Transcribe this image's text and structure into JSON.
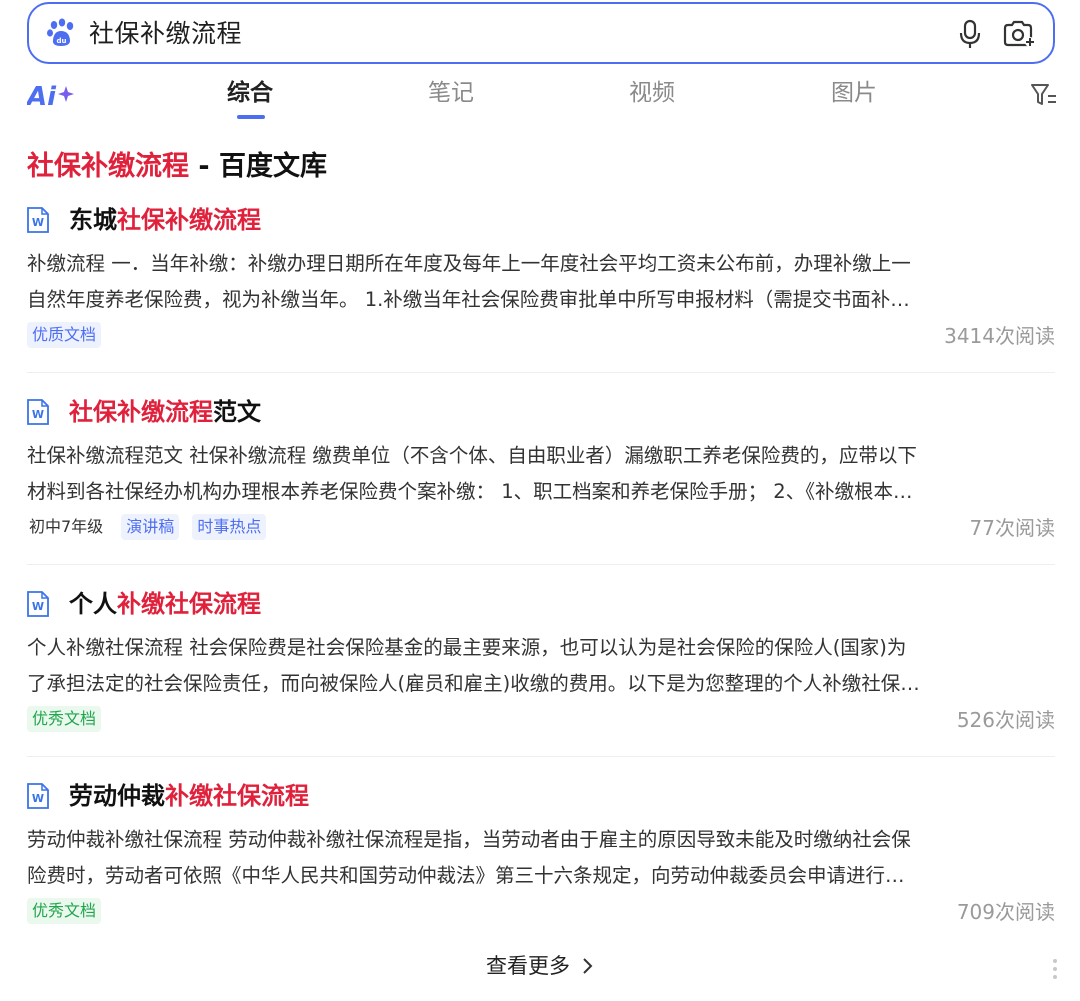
{
  "search": {
    "query": "社保补缴流程"
  },
  "tabs": [
    {
      "label": "综合",
      "active": true
    },
    {
      "label": "笔记",
      "active": false
    },
    {
      "label": "视频",
      "active": false
    },
    {
      "label": "图片",
      "active": false
    }
  ],
  "section": {
    "title_highlight": "社保补缴流程",
    "title_rest": " - 百度文库"
  },
  "results": [
    {
      "title_pre": "东城",
      "title_hl": "社保补缴流程",
      "title_post": "",
      "snippet_line1": "补缴流程 一．当年补缴：补缴办理日期所在年度及每年上一年度社会平均工资未公布前，办理补缴上一",
      "snippet_line2": "自然年度养老保险费，视为补缴当年。 1.补缴当年社会保险费审批单中所写申报材料（需提交书面补…",
      "tags": [
        {
          "label": "优质文档",
          "style": "blue"
        }
      ],
      "reads": "3414次阅读"
    },
    {
      "title_pre": "",
      "title_hl": "社保补缴流程",
      "title_post": "范文",
      "snippet_line1": "社保补缴流程范文 社保补缴流程 缴费单位（不含个体、自由职业者）漏缴职工养老保险费的，应带以下",
      "snippet_line2": "材料到各社保经办机构办理根本养老保险费个案补缴： 1、职工档案和养老保险手册； 2、《补缴根本…",
      "tags": [
        {
          "label": "初中7年级",
          "style": "plain"
        },
        {
          "label": "演讲稿",
          "style": "blue"
        },
        {
          "label": "时事热点",
          "style": "blue"
        }
      ],
      "reads": "77次阅读"
    },
    {
      "title_pre": "个人",
      "title_hl": "补缴社保流程",
      "title_post": "",
      "snippet_line1": "个人补缴社保流程 社会保险费是社会保险基金的最主要来源，也可以认为是社会保险的保险人(国家)为",
      "snippet_line2": "了承担法定的社会保险责任，而向被保险人(雇员和雇主)收缴的费用。以下是为您整理的个人补缴社保…",
      "tags": [
        {
          "label": "优秀文档",
          "style": "green"
        }
      ],
      "reads": "526次阅读"
    },
    {
      "title_pre": "劳动仲裁",
      "title_hl": "补缴社保流程",
      "title_post": "",
      "snippet_line1": "劳动仲裁补缴社保流程 劳动仲裁补缴社保流程是指，当劳动者由于雇主的原因导致未能及时缴纳社会保",
      "snippet_line2": "险费时，劳动者可依照《中华人民共和国劳动仲裁法》第三十六条规定，向劳动仲裁委员会申请进行…",
      "tags": [
        {
          "label": "优秀文档",
          "style": "green"
        }
      ],
      "reads": "709次阅读"
    }
  ],
  "more": {
    "label": "查看更多"
  },
  "colors": {
    "accent": "#4e6ef2",
    "highlight": "#e0213c",
    "tag_green": "#21a54d"
  }
}
